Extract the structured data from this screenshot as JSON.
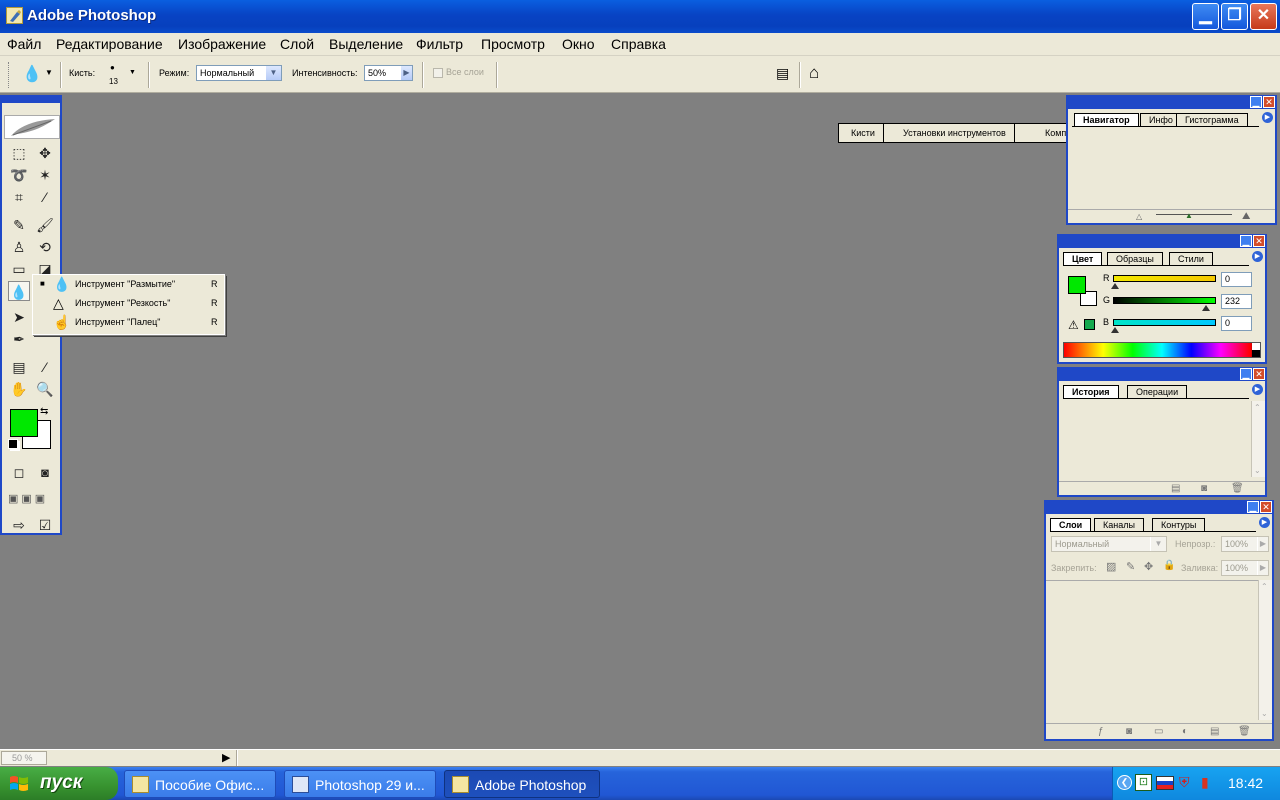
{
  "window": {
    "title": "Adobe Photoshop"
  },
  "menu": [
    "Файл",
    "Редактирование",
    "Изображение",
    "Слой",
    "Выделение",
    "Фильтр",
    "Просмотр",
    "Окно",
    "Справка"
  ],
  "options": {
    "brush_label": "Кисть:",
    "brush_size": "13",
    "mode_label": "Режим:",
    "mode_value": "Нормальный",
    "intensity_label": "Интенсивность:",
    "intensity_value": "50%",
    "all_layers_label": "Все слои"
  },
  "well_tabs": [
    "Кисти",
    "Установки инструментов",
    "Композиции слоев"
  ],
  "flyout": [
    {
      "label": "Инструмент \"Размытие\"",
      "key": "R",
      "icon": "blur-drop-icon",
      "selected": true
    },
    {
      "label": "Инструмент \"Резкость\"",
      "key": "R",
      "icon": "sharpen-triangle-icon",
      "selected": false
    },
    {
      "label": "Инструмент \"Палец\"",
      "key": "R",
      "icon": "smudge-finger-icon",
      "selected": false
    }
  ],
  "navigator": {
    "tabs": [
      "Навигатор",
      "Инфо",
      "Гистограмма"
    ]
  },
  "color": {
    "tabs": [
      "Цвет",
      "Образцы",
      "Стили"
    ],
    "r_label": "R",
    "g_label": "G",
    "b_label": "B",
    "r": "0",
    "g": "232",
    "b": "0",
    "foreground": "#00e800"
  },
  "history": {
    "tabs": [
      "История",
      "Операции"
    ]
  },
  "layers": {
    "tabs": [
      "Слои",
      "Каналы",
      "Контуры"
    ],
    "blend": "Нормальный",
    "opacity_label": "Непрозр.:",
    "opacity": "100%",
    "lock_label": "Закрепить:",
    "fill_label": "Заливка:",
    "fill": "100%"
  },
  "status": {
    "zoom": "50 %"
  },
  "taskbar": {
    "start": "пуск",
    "tasks": [
      {
        "label": "Пособие Офис...",
        "icon": "folder-icon",
        "active": false
      },
      {
        "label": "Photoshop 29 и...",
        "icon": "word-icon",
        "active": false
      },
      {
        "label": "Adobe Photoshop",
        "icon": "photoshop-icon",
        "active": true
      }
    ],
    "clock": "18:42"
  },
  "colors": {
    "accent": "#1f48c7",
    "foreground_swatch": "#00e800",
    "background_swatch": "#ffffff"
  }
}
